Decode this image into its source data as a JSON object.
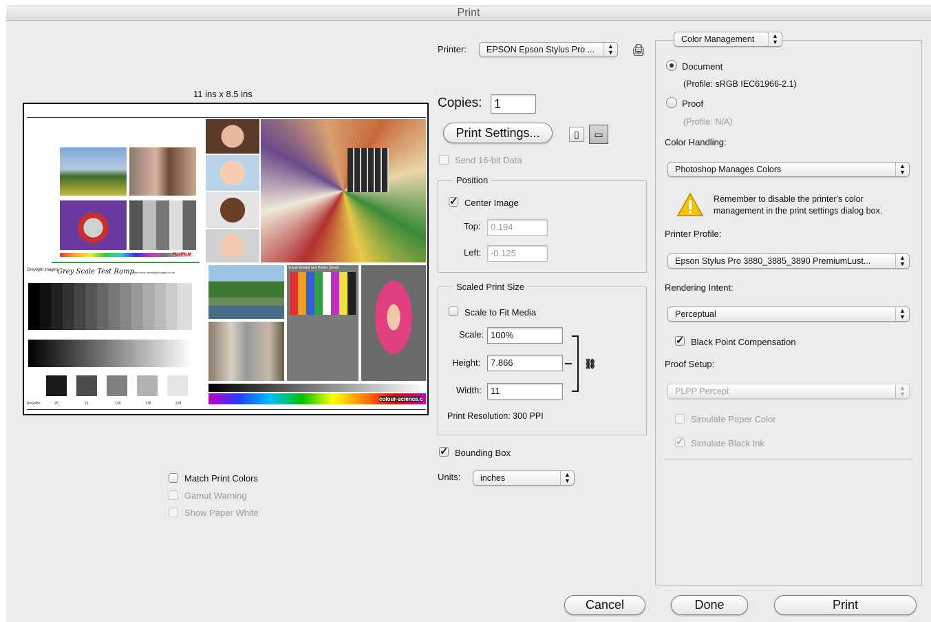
{
  "window": {
    "title": "Print"
  },
  "preview": {
    "size_label": "11 ins x 8.5 ins",
    "sheet": {
      "logo_text": "Greylight images",
      "ramp_title": "Grey Scale Test Ramp",
      "url_text": "http://www.northlight-images.co.uk",
      "fuji_text": "FUJIFILM",
      "colour_science_text": "colour-science.c",
      "visual_monitor_text": "Visual Monitor and Printer Check",
      "patch_values": [
        "25",
        "76",
        "128",
        "178",
        "229"
      ],
      "rgb_label": "R=G=B="
    },
    "options": {
      "match_print_colors": {
        "label": "Match Print Colors",
        "checked": false
      },
      "gamut_warning": {
        "label": "Gamut Warning",
        "checked": false,
        "disabled": true
      },
      "show_paper_white": {
        "label": "Show Paper White",
        "checked": false,
        "disabled": true
      }
    }
  },
  "printer": {
    "label": "Printer:",
    "value": "EPSON Epson Stylus Pro ...",
    "icon": "printer-add-icon"
  },
  "copies": {
    "label": "Copies:",
    "value": "1"
  },
  "print_settings": {
    "label": "Print Settings...",
    "orientation_icons": [
      "portrait-orientation-icon",
      "landscape-orientation-icon"
    ]
  },
  "send16bit": {
    "label": "Send 16-bit Data",
    "checked": false,
    "disabled": true
  },
  "position": {
    "title": "Position",
    "center_image": {
      "label": "Center Image",
      "checked": true
    },
    "top": {
      "label": "Top:",
      "value": "0.194"
    },
    "left": {
      "label": "Left:",
      "value": "-0.125"
    }
  },
  "scaled": {
    "title": "Scaled Print Size",
    "scale_to_fit": {
      "label": "Scale to Fit Media",
      "checked": false
    },
    "scale": {
      "label": "Scale:",
      "value": "100%"
    },
    "height": {
      "label": "Height:",
      "value": "7.866"
    },
    "width": {
      "label": "Width:",
      "value": "11"
    },
    "link_icon": "chain-link-icon",
    "resolution": "Print Resolution: 300 PPI"
  },
  "bounding_box": {
    "label": "Bounding Box",
    "checked": true
  },
  "units": {
    "label": "Units:",
    "value": "inches"
  },
  "color_mgmt": {
    "section": "Color Management",
    "document": {
      "label": "Document",
      "selected": true,
      "profile": "(Profile: sRGB IEC61966-2.1)"
    },
    "proof": {
      "label": "Proof",
      "selected": false,
      "profile": "(Profile: N/A)"
    },
    "handling_label": "Color Handling:",
    "handling_value": "Photoshop Manages Colors",
    "warning_icon": "warning-triangle-icon",
    "warning_text": "Remember to disable the printer's color management in the print settings dialog box.",
    "printer_profile_label": "Printer Profile:",
    "printer_profile_value": "Epson Stylus Pro 3880_3885_3890 PremiumLust...",
    "rendering_label": "Rendering Intent:",
    "rendering_value": "Perceptual",
    "bpc": {
      "label": "Black Point Compensation",
      "checked": true
    },
    "proof_setup_label": "Proof Setup:",
    "proof_setup_value": "PLPP Percept",
    "simulate_paper": {
      "label": "Simulate Paper Color",
      "checked": false,
      "disabled": true
    },
    "simulate_ink": {
      "label": "Simulate Black Ink",
      "checked": true,
      "disabled": true
    }
  },
  "buttons": {
    "cancel": "Cancel",
    "done": "Done",
    "print": "Print"
  },
  "colors": {
    "accent_warning": "#f5c400",
    "dialog_bg": "#ececec"
  }
}
